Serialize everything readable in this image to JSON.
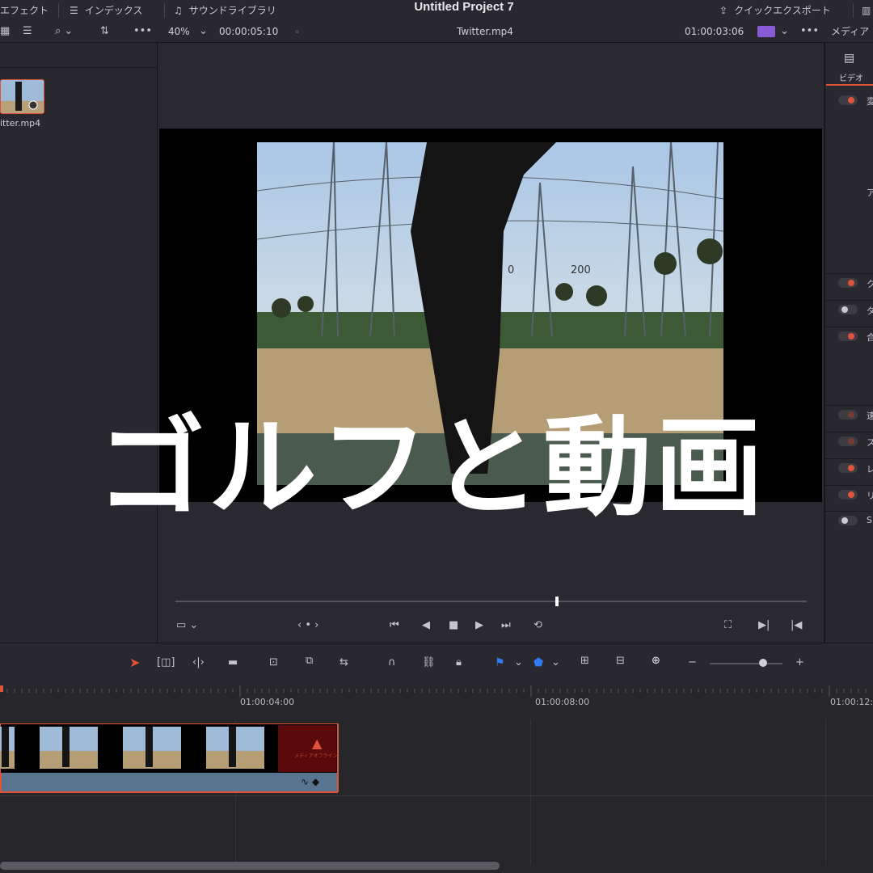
{
  "topbar": {
    "effects_label": "エフェクト",
    "index_label": "インデックス",
    "sound_library_label": "サウンドライブラリ",
    "project_title": "Untitled Project 7",
    "quick_export_label": "クイックエクスポート"
  },
  "viewer_bar": {
    "zoom": "40%",
    "timecode_duration": "00:00:05:10",
    "clip_name": "Twitter.mp4",
    "timecode_current": "01:00:03:06",
    "inspector_label": "メディア"
  },
  "media_pool": {
    "clip_label": "itter.mp4"
  },
  "inspector": {
    "tab_video": "ビデオ",
    "items": [
      {
        "label": "変",
        "on": true
      },
      {
        "label": "ク",
        "on": true
      },
      {
        "label": "ダ",
        "on": false
      },
      {
        "label": "合",
        "on": true
      },
      {
        "label": "速",
        "on": true,
        "dim": true
      },
      {
        "label": "ス",
        "on": true,
        "dim": true
      },
      {
        "label": "レ",
        "on": true
      },
      {
        "label": "リ",
        "on": true
      },
      {
        "label": "S",
        "on": false
      }
    ],
    "side_letter": "ア"
  },
  "overlay": {
    "caption": "ゴルフと動画"
  },
  "photo": {
    "sign_a": "0",
    "sign_b": "200"
  },
  "timeline": {
    "ruler_labels": [
      "01:00:04:00",
      "01:00:08:00",
      "01:00:12:0"
    ],
    "clip_warning_text": "メディアオフライン"
  },
  "colors": {
    "accent": "#e0533a",
    "panel": "#28282e",
    "viewer": "#29292f",
    "audio_track": "#59748f",
    "marker_blue": "#2f7bf0"
  }
}
